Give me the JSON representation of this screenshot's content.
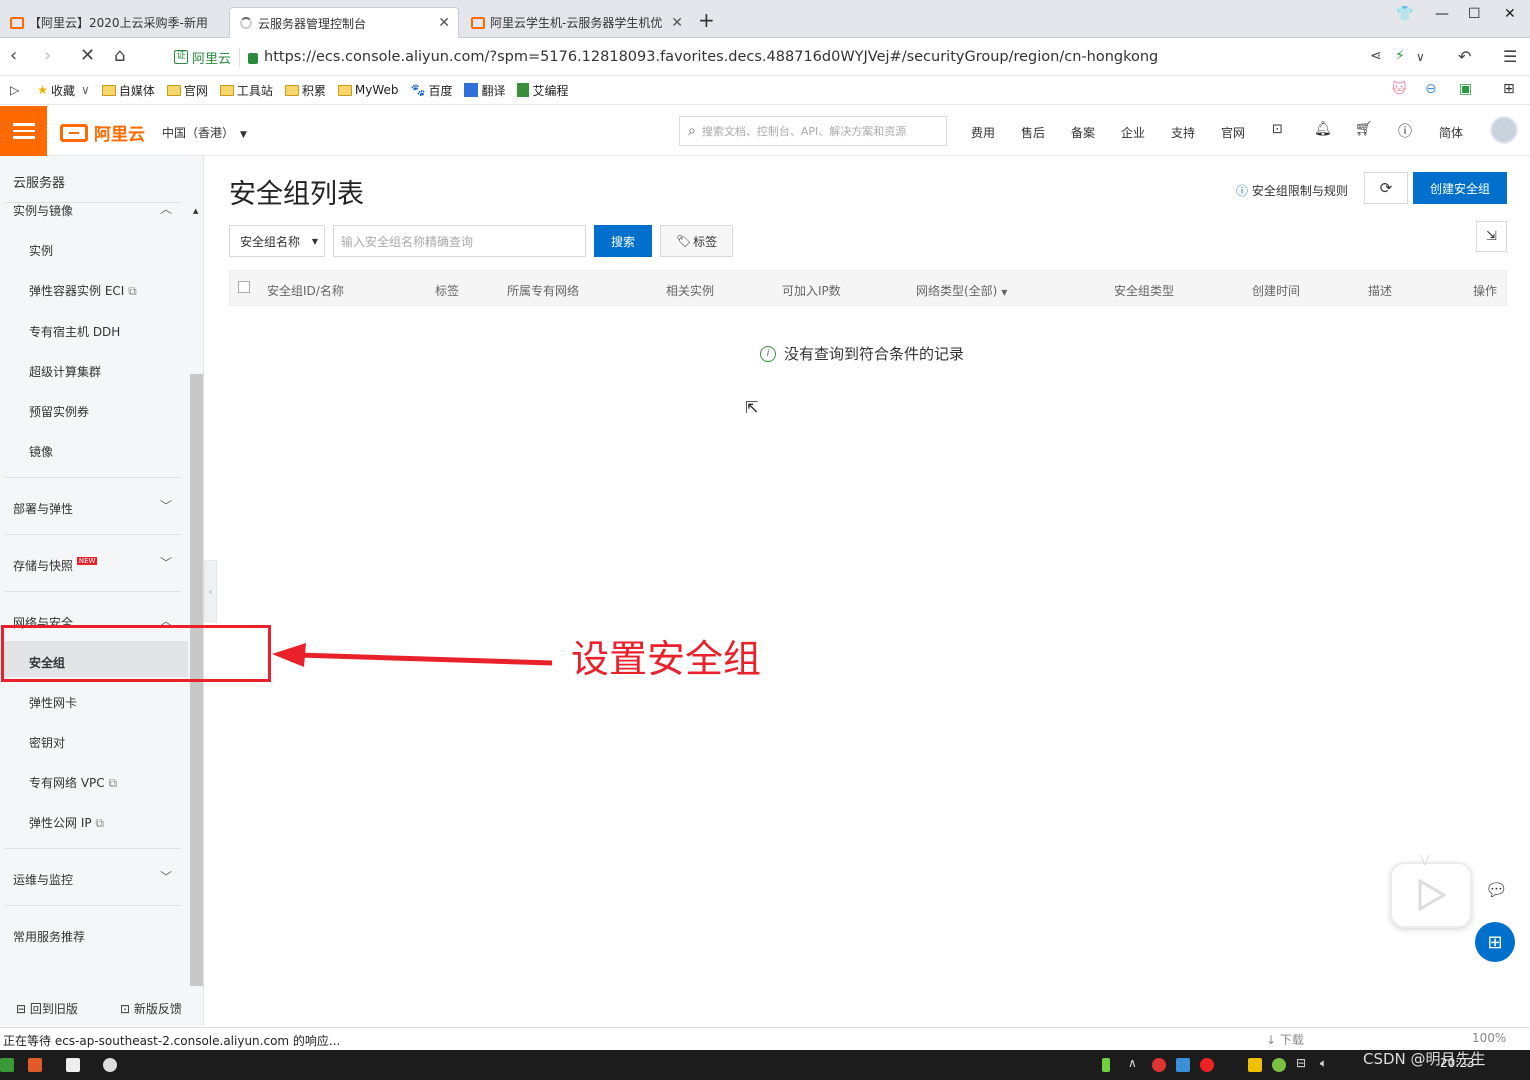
{
  "browser": {
    "tabs": [
      {
        "title": "【阿里云】2020上云采购季-新用"
      },
      {
        "title": "云服务器管理控制台"
      },
      {
        "title": "阿里云学生机-云服务器学生机优"
      }
    ],
    "new_tab": "+",
    "url_badge": "阿里云",
    "url": "https://ecs.console.aliyun.com/?spm=5176.12818093.favorites.decs.488716d0WYJVej#/securityGroup/region/cn-hongkong",
    "bookmarks": [
      "收藏",
      "自媒体",
      "官网",
      "工具站",
      "积累",
      "MyWeb",
      "百度",
      "翻译",
      "艾编程"
    ],
    "status_text": "正在等待 ecs-ap-southeast-2.console.aliyun.com 的响应...",
    "zoom": "100%",
    "download_label": "下载",
    "clock": "20:23"
  },
  "header": {
    "logo_text": "阿里云",
    "region": "中国（香港）",
    "search_placeholder": "搜索文档、控制台、API、解决方案和资源",
    "nav": [
      "费用",
      "售后",
      "备案",
      "企业",
      "支持",
      "官网"
    ],
    "lang": "简体"
  },
  "sidebar": {
    "title": "云服务器",
    "group_instances": "实例与镜像",
    "instance_items": [
      "实例",
      "弹性容器实例 ECI",
      "专有宿主机 DDH",
      "超级计算集群",
      "预留实例券",
      "镜像"
    ],
    "group_deploy": "部署与弹性",
    "group_storage": "存储与快照",
    "new_badge": "NEW",
    "group_network": "网络与安全",
    "network_items": [
      "安全组",
      "弹性网卡",
      "密钥对",
      "专有网络 VPC",
      "弹性公网 IP"
    ],
    "group_ops": "运维与监控",
    "group_recommend": "常用服务推荐",
    "footer_back": "回到旧版",
    "footer_feedback": "新版反馈"
  },
  "main": {
    "page_title": "安全组列表",
    "help_link": "安全组限制与规则",
    "create_button": "创建安全组",
    "filter_select": "安全组名称",
    "search_placeholder": "输入安全组名称精确查询",
    "search_button": "搜索",
    "tag_button": "标签",
    "columns": [
      "安全组ID/名称",
      "标签",
      "所属专有网络",
      "相关实例",
      "可加入IP数",
      "网络类型(全部)",
      "安全组类型",
      "创建时间",
      "描述",
      "操作"
    ],
    "empty_message": "没有查询到符合条件的记录"
  },
  "annotation": {
    "text": "设置安全组"
  },
  "watermark": {
    "text": "CSDN @明月先生"
  },
  "colors": {
    "brand": "#ff6a00",
    "primary": "#0070cc",
    "annotation": "#e8212b"
  }
}
